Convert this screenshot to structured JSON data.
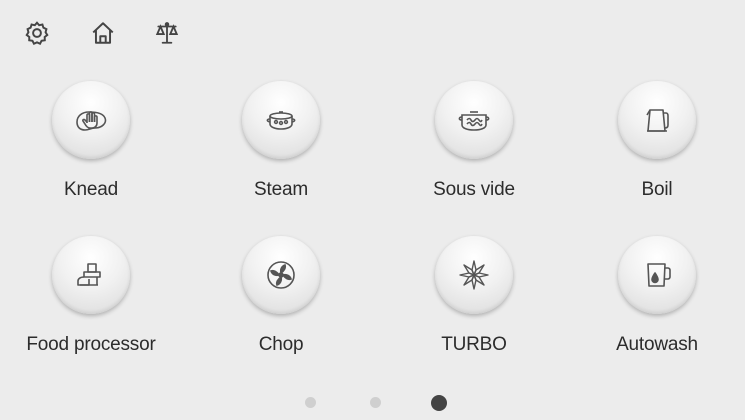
{
  "topbar": {
    "icons": [
      "gear-icon",
      "home-icon",
      "scale-icon"
    ]
  },
  "programs": [
    {
      "label": "Knead",
      "icon": "knead-icon"
    },
    {
      "label": "Steam",
      "icon": "steam-icon"
    },
    {
      "label": "Sous vide",
      "icon": "sous-vide-icon"
    },
    {
      "label": "Boil",
      "icon": "kettle-icon"
    },
    {
      "label": "Food processor",
      "icon": "food-processor-icon"
    },
    {
      "label": "Chop",
      "icon": "chop-icon"
    },
    {
      "label": "TURBO",
      "icon": "turbo-icon"
    },
    {
      "label": "Autowash",
      "icon": "autowash-icon"
    }
  ],
  "pagination": {
    "pages": 3,
    "current": 3
  },
  "colors": {
    "background": "#ececec",
    "icon": "#444444",
    "active_dot": "#444444",
    "inactive_dot": "#cfcfcf"
  }
}
